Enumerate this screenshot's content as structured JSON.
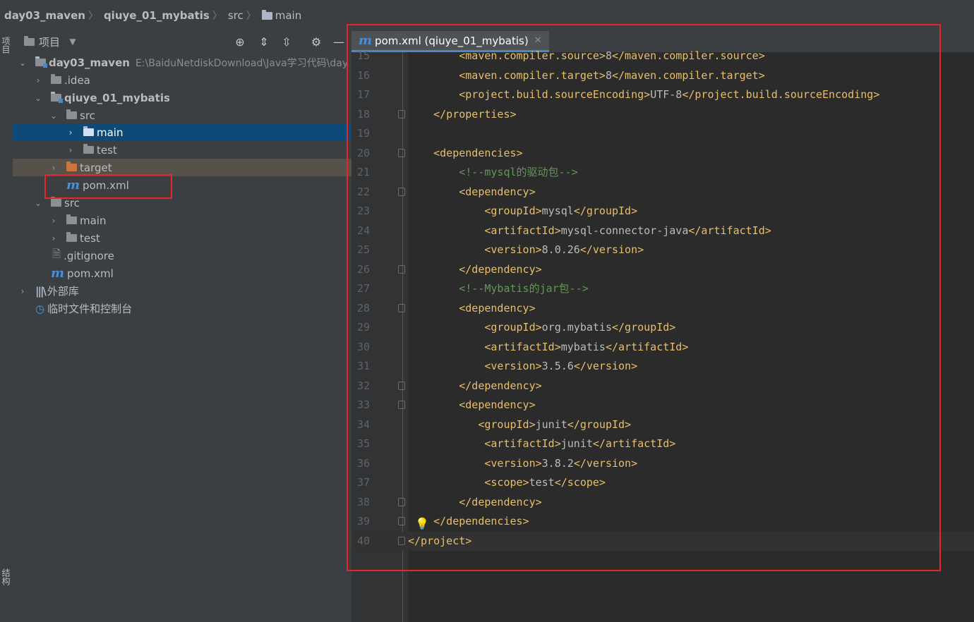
{
  "breadcrumb": {
    "items": [
      "day03_maven",
      "qiuye_01_mybatis",
      "src",
      "main"
    ]
  },
  "side_strip": {
    "top_label": "项目",
    "bottom_label": "结构"
  },
  "project_panel": {
    "title": "项目",
    "tree": [
      {
        "label": "day03_maven",
        "hint": "E:\\BaiduNetdiskDownload\\Java学习代码\\day"
      },
      {
        "label": ".idea"
      },
      {
        "label": "qiuye_01_mybatis"
      },
      {
        "label": "src"
      },
      {
        "label": "main"
      },
      {
        "label": "test"
      },
      {
        "label": "target"
      },
      {
        "label": "pom.xml"
      },
      {
        "label": "src"
      },
      {
        "label": "main"
      },
      {
        "label": "test"
      },
      {
        "label": ".gitignore"
      },
      {
        "label": "pom.xml"
      },
      {
        "label": "外部库"
      },
      {
        "label": "临时文件和控制台"
      }
    ]
  },
  "editor": {
    "tab_label": "pom.xml (qiuye_01_mybatis)",
    "lines": [
      {
        "n": "15",
        "code": "        <maven.compiler.source>8</maven.compiler.source>"
      },
      {
        "n": "16",
        "code": "        <maven.compiler.target>8</maven.compiler.target>"
      },
      {
        "n": "17",
        "code": "        <project.build.sourceEncoding>UTF-8</project.build.sourceEncoding>"
      },
      {
        "n": "18",
        "code": "    </properties>"
      },
      {
        "n": "19",
        "code": ""
      },
      {
        "n": "20",
        "code": "    <dependencies>"
      },
      {
        "n": "21",
        "code": "        <!--mysql的驱动包-->"
      },
      {
        "n": "22",
        "code": "        <dependency>"
      },
      {
        "n": "23",
        "code": "            <groupId>mysql</groupId>"
      },
      {
        "n": "24",
        "code": "            <artifactId>mysql-connector-java</artifactId>"
      },
      {
        "n": "25",
        "code": "            <version>8.0.26</version>"
      },
      {
        "n": "26",
        "code": "        </dependency>"
      },
      {
        "n": "27",
        "code": "        <!--Mybatis的jar包-->"
      },
      {
        "n": "28",
        "code": "        <dependency>"
      },
      {
        "n": "29",
        "code": "            <groupId>org.mybatis</groupId>"
      },
      {
        "n": "30",
        "code": "            <artifactId>mybatis</artifactId>"
      },
      {
        "n": "31",
        "code": "            <version>3.5.6</version>"
      },
      {
        "n": "32",
        "code": "        </dependency>"
      },
      {
        "n": "33",
        "code": "        <dependency>"
      },
      {
        "n": "34",
        "code": "           <groupId>junit</groupId>"
      },
      {
        "n": "35",
        "code": "            <artifactId>junit</artifactId>"
      },
      {
        "n": "36",
        "code": "            <version>3.8.2</version>"
      },
      {
        "n": "37",
        "code": "            <scope>test</scope>"
      },
      {
        "n": "38",
        "code": "        </dependency>"
      },
      {
        "n": "39",
        "code": "    </dependencies>"
      },
      {
        "n": "40",
        "code": "</project>"
      }
    ]
  },
  "colors": {
    "highlight_box": "#e8252b",
    "selection": "#0d4a78",
    "tag": "#e8bf6a",
    "comment": "#629755"
  }
}
